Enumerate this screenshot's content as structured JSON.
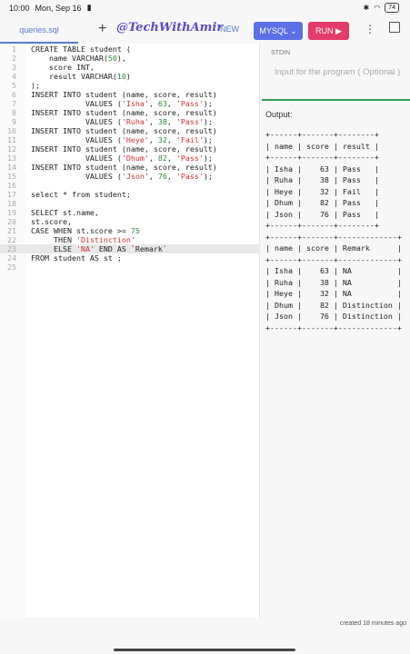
{
  "status": {
    "time": "10:00",
    "date": "Mon, Sep 16",
    "battery": "74"
  },
  "toolbar": {
    "tab_label": "queries.sql",
    "watermark": "@TechWithAmir",
    "new_label": "NEW",
    "db_label": "MYSQL",
    "run_label": "RUN"
  },
  "editor": {
    "active_line": 23,
    "lines": [
      "CREATE TABLE student (",
      "    name VARCHAR(50),",
      "    score INT,",
      "    result VARCHAR(10)",
      ");",
      "INSERT INTO student (name, score, result)",
      "            VALUES ('Isha', 63, 'Pass');",
      "INSERT INTO student (name, score, result)",
      "            VALUES ('Ruha', 38, 'Pass');",
      "INSERT INTO student (name, score, result)",
      "            VALUES ('Heye', 32, 'Fail');",
      "INSERT INTO student (name, score, result)",
      "            VALUES ('Dhum', 82, 'Pass');",
      "INSERT INTO student (name, score, result)",
      "            VALUES ('Json', 76, 'Pass');",
      "",
      "select * from student;",
      "",
      "SELECT st.name,",
      "st.score,",
      "CASE WHEN st.score >= 75",
      "     THEN 'Distinction'",
      "     ELSE 'NA' END AS `Remark`",
      "FROM student AS st ;",
      ""
    ]
  },
  "stdin": {
    "label": "STDIN",
    "placeholder": "Input for the program ( Optional )"
  },
  "output": {
    "label": "Output:",
    "text": "+------+-------+--------+\n| name | score | result |\n+------+-------+--------+\n| Isha |    63 | Pass   |\n| Ruha |    38 | Pass   |\n| Heye |    32 | Fail   |\n| Dhum |    82 | Pass   |\n| Json |    76 | Pass   |\n+------+-------+--------+\n+------+-------+-------------+\n| name | score | Remark      |\n+------+-------+-------------+\n| Isha |    63 | NA          |\n| Ruha |    38 | NA          |\n| Heye |    32 | NA          |\n| Dhum |    82 | Distinction |\n| Json |    76 | Distinction |\n+------+-------+-------------+"
  },
  "footer": {
    "created": "created 18 minutes ago"
  }
}
